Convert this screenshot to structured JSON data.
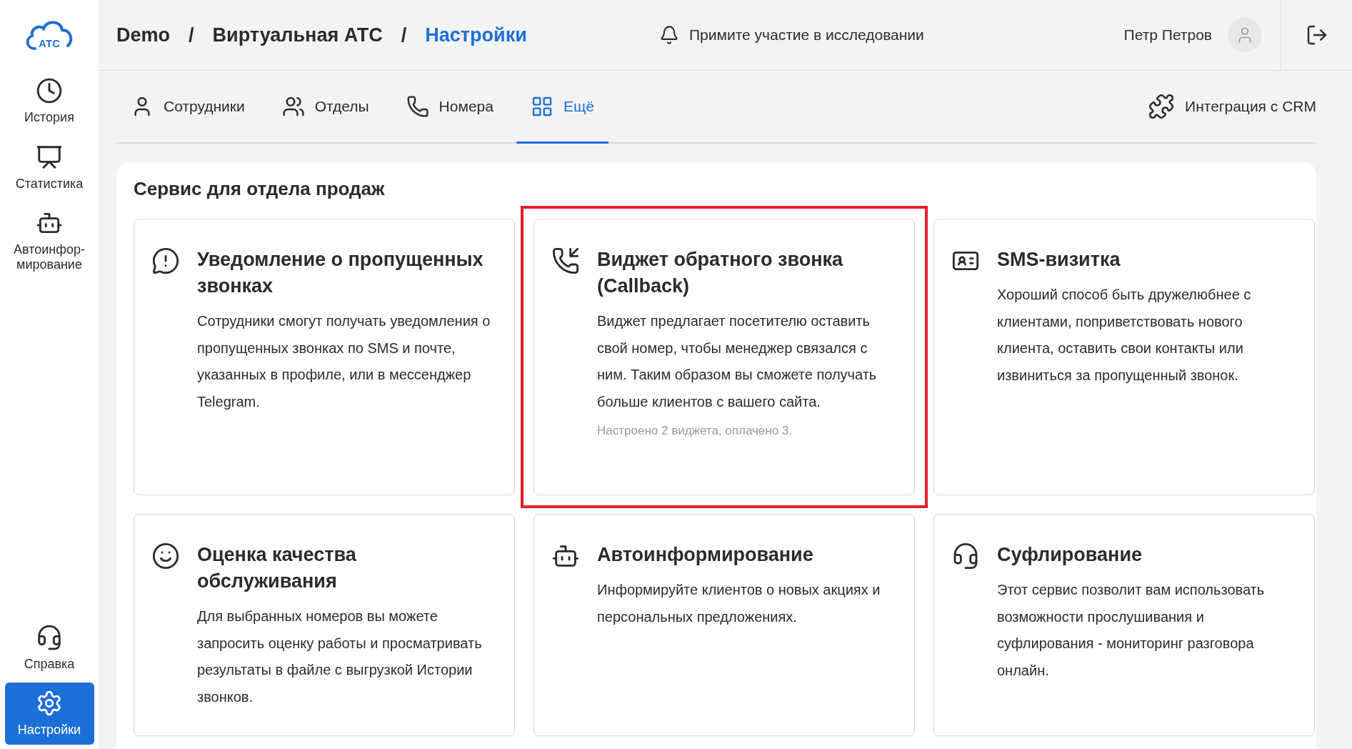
{
  "logo": {
    "text": "АТС"
  },
  "sidebar": {
    "items": [
      {
        "label": "История",
        "selected": false
      },
      {
        "label": "Статистика",
        "selected": false
      },
      {
        "label": "Автоинфор-\nмирование",
        "selected": false
      }
    ],
    "bottom_items": [
      {
        "label": "Справка",
        "selected": false
      },
      {
        "label": "Настройки",
        "selected": true
      }
    ]
  },
  "breadcrumb": {
    "separator": "/",
    "items": [
      {
        "label": "Demo",
        "current": false
      },
      {
        "label": "Виртуальная АТС",
        "current": false
      },
      {
        "label": "Настройки",
        "current": true
      }
    ]
  },
  "survey_link": "Примите участие в исследовании",
  "user": {
    "name": "Петр Петров"
  },
  "tabs": [
    {
      "label": "Сотрудники",
      "selected": false
    },
    {
      "label": "Отделы",
      "selected": false
    },
    {
      "label": "Номера",
      "selected": false
    },
    {
      "label": "Ещё",
      "selected": true
    }
  ],
  "crm_link": "Интеграция с CRM",
  "section": {
    "title": "Сервис для отдела продаж",
    "cards": [
      {
        "title": "Уведомление о пропущенных звонках",
        "description": "Сотрудники смогут получать уведомления о пропущенных звонках по SMS и почте, указанных в профиле, или в мессенджер Telegram.",
        "highlighted": false
      },
      {
        "title": "Виджет обратного звонка (Callback)",
        "description": "Виджет предлагает посетителю оставить свой номер, чтобы менеджер связался с ним. Таким образом вы сможете получать больше клиентов с вашего сайта.",
        "note": "Настроено 2 виджета, оплачено 3.",
        "highlighted": true
      },
      {
        "title": "SMS-визитка",
        "description": "Хороший способ быть дружелюбнее с клиентами, поприветствовать нового клиента, оставить свои контакты или извиниться за пропущенный звонок.",
        "highlighted": false
      },
      {
        "title": "Оценка качества обслуживания",
        "description": "Для выбранных номеров вы можете запросить оценку работы и просматривать результаты в файле с выгрузкой Истории звонков.",
        "highlighted": false
      },
      {
        "title": "Автоинформирование",
        "description": "Информируйте клиентов о новых акциях и персональных предложениях.",
        "highlighted": false
      },
      {
        "title": "Суфлирование",
        "description": "Этот сервис позволит вам использовать возможности прослушивания и суфлирования - мониторинг разговора онлайн.",
        "highlighted": false
      }
    ]
  }
}
